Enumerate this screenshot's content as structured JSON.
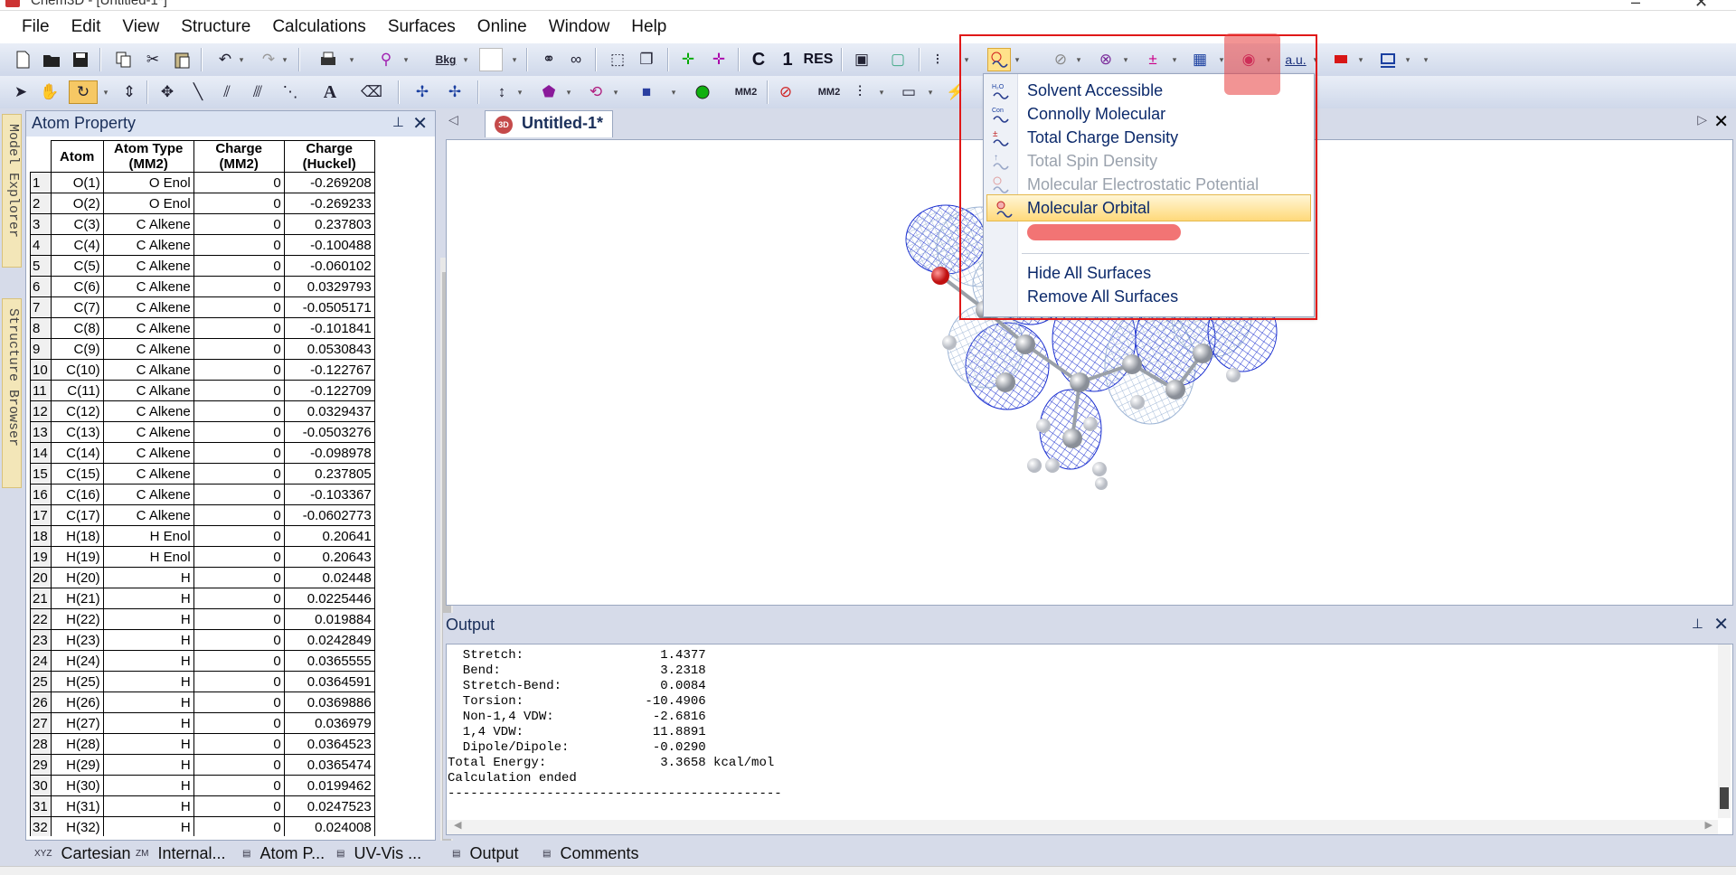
{
  "app": {
    "title": "Chem3D - [Untitled-1*]"
  },
  "menubar": [
    "File",
    "Edit",
    "View",
    "Structure",
    "Calculations",
    "Surfaces",
    "Online",
    "Window",
    "Help"
  ],
  "toolbar1": {
    "bkg_label": "Bkg",
    "labels": [
      "C",
      "1",
      "RES",
      "a.u."
    ]
  },
  "toolbar2": {
    "labels": [
      "A",
      "MM2",
      "MM2"
    ]
  },
  "left_tabs": [
    "Model Explorer",
    "Structure Browser"
  ],
  "atom_property": {
    "title": "Atom Property",
    "columns": [
      "Atom",
      "Atom Type (MM2)",
      "Charge (MM2)",
      "Charge (Huckel)"
    ],
    "rows": [
      [
        "1",
        "O(1)",
        "O Enol",
        "0",
        "-0.269208"
      ],
      [
        "2",
        "O(2)",
        "O Enol",
        "0",
        "-0.269233"
      ],
      [
        "3",
        "C(3)",
        "C Alkene",
        "0",
        "0.237803"
      ],
      [
        "4",
        "C(4)",
        "C Alkene",
        "0",
        "-0.100488"
      ],
      [
        "5",
        "C(5)",
        "C Alkene",
        "0",
        "-0.060102"
      ],
      [
        "6",
        "C(6)",
        "C Alkene",
        "0",
        "0.0329793"
      ],
      [
        "7",
        "C(7)",
        "C Alkene",
        "0",
        "-0.0505171"
      ],
      [
        "8",
        "C(8)",
        "C Alkene",
        "0",
        "-0.101841"
      ],
      [
        "9",
        "C(9)",
        "C Alkene",
        "0",
        "0.0530843"
      ],
      [
        "10",
        "C(10)",
        "C Alkane",
        "0",
        "-0.122767"
      ],
      [
        "11",
        "C(11)",
        "C Alkane",
        "0",
        "-0.122709"
      ],
      [
        "12",
        "C(12)",
        "C Alkene",
        "0",
        "0.0329437"
      ],
      [
        "13",
        "C(13)",
        "C Alkene",
        "0",
        "-0.0503276"
      ],
      [
        "14",
        "C(14)",
        "C Alkene",
        "0",
        "-0.098978"
      ],
      [
        "15",
        "C(15)",
        "C Alkene",
        "0",
        "0.237805"
      ],
      [
        "16",
        "C(16)",
        "C Alkene",
        "0",
        "-0.103367"
      ],
      [
        "17",
        "C(17)",
        "C Alkene",
        "0",
        "-0.0602773"
      ],
      [
        "18",
        "H(18)",
        "H Enol",
        "0",
        "0.20641"
      ],
      [
        "19",
        "H(19)",
        "H Enol",
        "0",
        "0.20643"
      ],
      [
        "20",
        "H(20)",
        "H",
        "0",
        "0.02448"
      ],
      [
        "21",
        "H(21)",
        "H",
        "0",
        "0.0225446"
      ],
      [
        "22",
        "H(22)",
        "H",
        "0",
        "0.019884"
      ],
      [
        "23",
        "H(23)",
        "H",
        "0",
        "0.0242849"
      ],
      [
        "24",
        "H(24)",
        "H",
        "0",
        "0.0365555"
      ],
      [
        "25",
        "H(25)",
        "H",
        "0",
        "0.0364591"
      ],
      [
        "26",
        "H(26)",
        "H",
        "0",
        "0.0369886"
      ],
      [
        "27",
        "H(27)",
        "H",
        "0",
        "0.036979"
      ],
      [
        "28",
        "H(28)",
        "H",
        "0",
        "0.0364523"
      ],
      [
        "29",
        "H(29)",
        "H",
        "0",
        "0.0365474"
      ],
      [
        "30",
        "H(30)",
        "H",
        "0",
        "0.0199462"
      ],
      [
        "31",
        "H(31)",
        "H",
        "0",
        "0.0247523"
      ],
      [
        "32",
        "H(32)",
        "H",
        "0",
        "0.024008"
      ]
    ]
  },
  "document": {
    "tab": "Untitled-1*"
  },
  "output": {
    "title": "Output",
    "text": "  Stretch:                  1.4377\n  Bend:                     3.2318\n  Stretch-Bend:             0.0084\n  Torsion:                -10.4906\n  Non-1,4 VDW:             -2.6816\n  1,4 VDW:                 11.8891\n  Dipole/Dipole:           -0.0290\nTotal Energy:               3.3658 kcal/mol\nCalculation ended\n--------------------------------------------"
  },
  "surfaces_menu": {
    "items": [
      {
        "label": "Solvent Accessible",
        "icon": "solvent-accessible-icon",
        "disabled": false
      },
      {
        "label": "Connolly Molecular",
        "icon": "connolly-molecular-icon",
        "disabled": false
      },
      {
        "label": "Total Charge Density",
        "icon": "total-charge-density-icon",
        "disabled": false
      },
      {
        "label": "Total Spin Density",
        "icon": "total-spin-density-icon",
        "disabled": true
      },
      {
        "label": "Molecular Electrostatic Potential",
        "icon": "electrostatic-potential-icon",
        "disabled": true
      },
      {
        "label": "Molecular Orbital",
        "icon": "molecular-orbital-icon",
        "disabled": false,
        "highlighted": true
      }
    ],
    "items2": [
      {
        "label": "Hide All Surfaces"
      },
      {
        "label": "Remove All Surfaces"
      }
    ]
  },
  "bottom_tabs": {
    "left": [
      {
        "label": "Cartesian",
        "icon": "XYZ"
      },
      {
        "label": "Internal...",
        "icon": "ZM"
      },
      {
        "label": "Atom P...",
        "icon": "atom-property-icon"
      },
      {
        "label": "UV-Vis ...",
        "icon": "uv-vis-icon"
      }
    ],
    "right": [
      {
        "label": "Output",
        "icon": "output-icon"
      },
      {
        "label": "Comments",
        "icon": "comments-icon"
      }
    ]
  },
  "colors": {
    "annotation_red": "#e01818",
    "menu_highlight": "#ffd97a",
    "wireframe_blue": "#1a2fd0",
    "wireframe_light": "#9fb6d6"
  }
}
